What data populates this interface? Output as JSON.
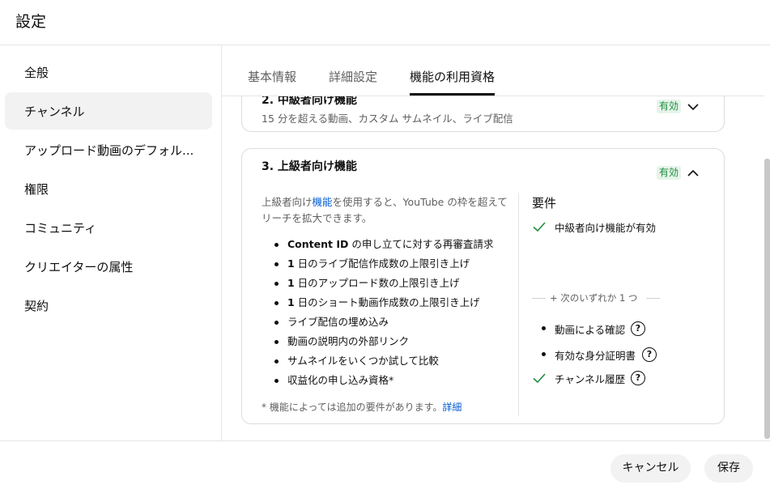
{
  "dialog": {
    "title": "設定"
  },
  "sidebar": {
    "items": [
      {
        "label": "全般"
      },
      {
        "label": "チャンネル"
      },
      {
        "label": "アップロード動画のデフォル..."
      },
      {
        "label": "権限"
      },
      {
        "label": "コミュニティ"
      },
      {
        "label": "クリエイターの属性"
      },
      {
        "label": "契約"
      }
    ],
    "active_index": 1
  },
  "tabs": [
    {
      "label": "基本情報"
    },
    {
      "label": "詳細設定"
    },
    {
      "label": "機能の利用資格"
    }
  ],
  "active_tab_index": 2,
  "sections": {
    "intermediate": {
      "title": "2. 中級者向け機能",
      "subtitle": "15 分を超える動画、カスタム サムネイル、ライブ配信",
      "status": "有効"
    },
    "advanced": {
      "title": "3. 上級者向け機能",
      "status": "有効",
      "desc_prefix": "上級者向け",
      "desc_link": "機能",
      "desc_suffix": "を使用すると、YouTube の枠を超えてリーチを拡大できます。",
      "features": [
        {
          "bold": "Content ID",
          "rest": " の申し立てに対する再審査請求"
        },
        {
          "bold": "1",
          "rest": " 日のライブ配信作成数の上限引き上げ"
        },
        {
          "bold": "1",
          "rest": " 日のアップロード数の上限引き上げ"
        },
        {
          "bold": "1",
          "rest": " 日のショート動画作成数の上限引き上げ"
        },
        {
          "bold": "",
          "rest": "ライブ配信の埋め込み"
        },
        {
          "bold": "",
          "rest": "動画の説明内の外部リンク"
        },
        {
          "bold": "",
          "rest": "サムネイルをいくつか試して比較"
        },
        {
          "bold": "",
          "rest": "収益化の申し込み資格*"
        }
      ],
      "footnote": "* 機能によっては追加の要件があります。",
      "footnote_link": "詳細",
      "requirements": {
        "title": "要件",
        "met_intermediate": "中級者向け機能が有効",
        "one_of": "+ 次のいずれか 1 つ",
        "option_video": "動画による確認",
        "option_id": "有効な身分証明書",
        "history": "チャンネル履歴",
        "help_glyph": "?"
      }
    }
  },
  "footer": {
    "cancel_label": "キャンセル",
    "save_label": "保存"
  },
  "colors": {
    "accent_link": "#065fd4",
    "success": "#1e8e3e",
    "badge_bg": "#e6f4ea"
  }
}
